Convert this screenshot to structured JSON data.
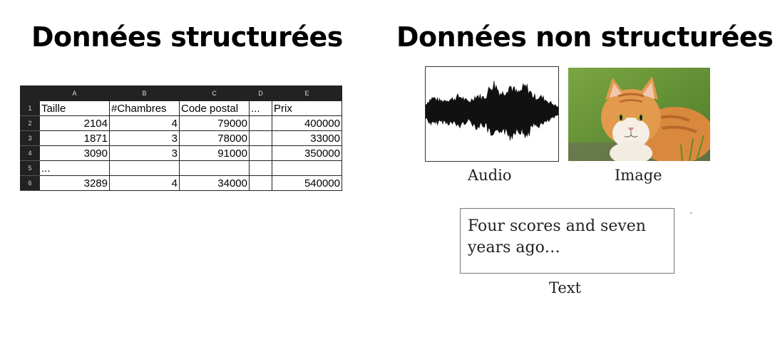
{
  "titles": {
    "structured": "Données structurées",
    "unstructured": "Données non structurées"
  },
  "sheet": {
    "columns": [
      "A",
      "B",
      "C",
      "D",
      "E"
    ],
    "rows": [
      {
        "num": "1",
        "cells": [
          "Taille",
          "#Chambres",
          "Code postal",
          "...",
          "Prix"
        ]
      },
      {
        "num": "2",
        "cells": [
          "2104",
          "4",
          "79000",
          "",
          "400000"
        ]
      },
      {
        "num": "3",
        "cells": [
          "1871",
          "3",
          "78000",
          "",
          "33000"
        ]
      },
      {
        "num": "4",
        "cells": [
          "3090",
          "3",
          "91000",
          "",
          "350000"
        ]
      },
      {
        "num": "5",
        "cells": [
          "...",
          "",
          "",
          "",
          ""
        ]
      },
      {
        "num": "6",
        "cells": [
          "3289",
          "4",
          "34000",
          "",
          "540000"
        ]
      }
    ]
  },
  "media": {
    "audio_label": "Audio",
    "image_label": "Image",
    "text_label": "Text",
    "text_content": "Four scores and seven years ago…"
  }
}
